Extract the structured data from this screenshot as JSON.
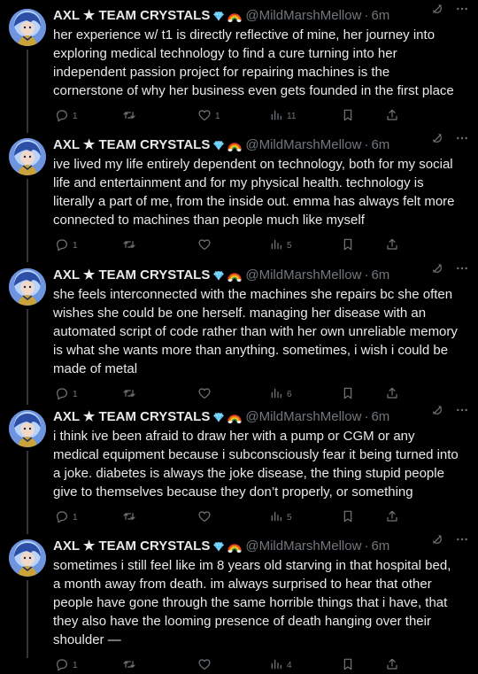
{
  "author": {
    "display_name": "AXL ★ TEAM CRYSTALS",
    "handle": "@MildMarshMellow",
    "dot": "·",
    "diamond_emoji": "diamond-icon",
    "rainbow_emoji": "rainbow-icon"
  },
  "colors": {
    "background": "#000000",
    "text": "#e7e9ea",
    "muted": "#71767b",
    "thread_line": "#333639"
  },
  "tweets": [
    {
      "time": "6m",
      "text": "her experience w/ t1 is directly reflective of mine, her journey into exploring medical technology to find a cure turning into her independent passion project for repairing machines is the cornerstone of why her business even gets founded in the first place",
      "replies": "1",
      "retweets": "",
      "likes": "1",
      "views": "11"
    },
    {
      "time": "6m",
      "text": "ive lived my life entirely dependent on technology, both for my social life and entertainment and for my physical health. technology is literally a part of me, from the inside out. emma has always felt more connected to machines than people much like myself",
      "replies": "1",
      "retweets": "",
      "likes": "",
      "views": "5"
    },
    {
      "time": "6m",
      "text": "she feels interconnected with the machines she repairs bc she often wishes she could be one herself. managing her disease with an automated script of code rather than with her own unreliable memory is what she wants more than anything. sometimes, i wish i could be made of metal",
      "replies": "1",
      "retweets": "",
      "likes": "",
      "views": "6"
    },
    {
      "time": "6m",
      "text": "i think ive been afraid to draw her with a pump or CGM or any medical equipment because i subconsciously fear it being turned into a joke. diabetes is always the joke disease, the thing stupid people give to themselves because they don’t properly, or something",
      "replies": "1",
      "retweets": "",
      "likes": "",
      "views": "5"
    },
    {
      "time": "6m",
      "text": "sometimes i still feel like im 8 years old starving in that hospital bed, a month away from death. im always surprised to hear that other people have gone through the same horrible things that i have, that they also have the looming presence of death hanging over their shoulder —",
      "replies": "1",
      "retweets": "",
      "likes": "",
      "views": "4"
    }
  ]
}
